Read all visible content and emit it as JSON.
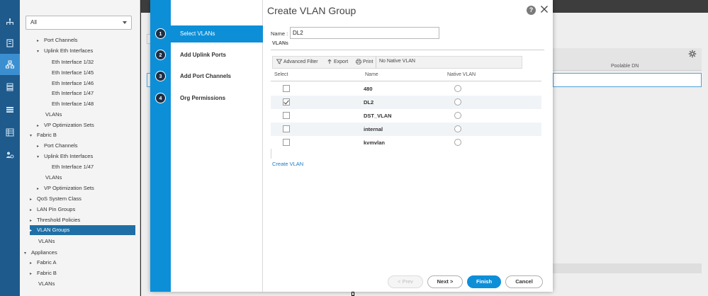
{
  "tree": {
    "filter_value": "All",
    "items": [
      {
        "label": "Port Channels",
        "twisty": "▸"
      },
      {
        "label": "Uplink Eth Interfaces",
        "twisty": "▾"
      },
      {
        "label": "Eth Interface 1/32",
        "twisty": ""
      },
      {
        "label": "Eth Interface 1/45",
        "twisty": ""
      },
      {
        "label": "Eth Interface 1/46",
        "twisty": ""
      },
      {
        "label": "Eth Interface 1/47",
        "twisty": ""
      },
      {
        "label": "Eth Interface 1/48",
        "twisty": ""
      },
      {
        "label": "VLANs",
        "twisty": ""
      },
      {
        "label": "VP Optimization Sets",
        "twisty": "▸"
      },
      {
        "label": "Fabric B",
        "twisty": "▾"
      },
      {
        "label": "Port Channels",
        "twisty": "▸"
      },
      {
        "label": "Uplink Eth Interfaces",
        "twisty": "▾"
      },
      {
        "label": "Eth Interface 1/47",
        "twisty": ""
      },
      {
        "label": "VLANs",
        "twisty": ""
      },
      {
        "label": "VP Optimization Sets",
        "twisty": "▸"
      },
      {
        "label": "QoS System Class",
        "twisty": "▸"
      },
      {
        "label": "LAN Pin Groups",
        "twisty": "▸"
      },
      {
        "label": "Threshold Policies",
        "twisty": "▸"
      },
      {
        "label": "VLAN Groups",
        "twisty": "▸"
      },
      {
        "label": "VLANs",
        "twisty": ""
      },
      {
        "label": "Appliances",
        "twisty": "▾"
      },
      {
        "label": "Fabric A",
        "twisty": "▸"
      },
      {
        "label": "Fabric B",
        "twisty": "▸"
      },
      {
        "label": "VLANs",
        "twisty": ""
      }
    ]
  },
  "background": {
    "column_label": "Poolable DN"
  },
  "modal": {
    "title": "Create VLAN Group",
    "help_glyph": "?",
    "steps": [
      {
        "num": "1",
        "label": "Select VLANs"
      },
      {
        "num": "2",
        "label": "Add Uplink Ports"
      },
      {
        "num": "3",
        "label": "Add Port Channels"
      },
      {
        "num": "4",
        "label": "Org Permissions"
      }
    ],
    "name_label": "Name :",
    "name_value": "DL2",
    "vlans_label": "VLANs",
    "toolbar": {
      "advanced_filter": "Advanced Filter",
      "export": "Export",
      "print": "Print",
      "native_vlan": "No Native VLAN"
    },
    "columns": {
      "select": "Select",
      "name": "Name",
      "native_vlan": "Native VLAN"
    },
    "rows": [
      {
        "name": "480",
        "checked": false
      },
      {
        "name": "DL2",
        "checked": true
      },
      {
        "name": "DST_VLAN",
        "checked": false
      },
      {
        "name": "internal",
        "checked": false
      },
      {
        "name": "kvmvlan",
        "checked": false
      }
    ],
    "create_vlan_link": "Create VLAN",
    "buttons": {
      "prev": "< Prev",
      "next": "Next >",
      "finish": "Finish",
      "cancel": "Cancel"
    }
  },
  "colors": {
    "accent": "#0d8fd8",
    "rail": "#1e5a8c",
    "link": "#1b78c2"
  }
}
